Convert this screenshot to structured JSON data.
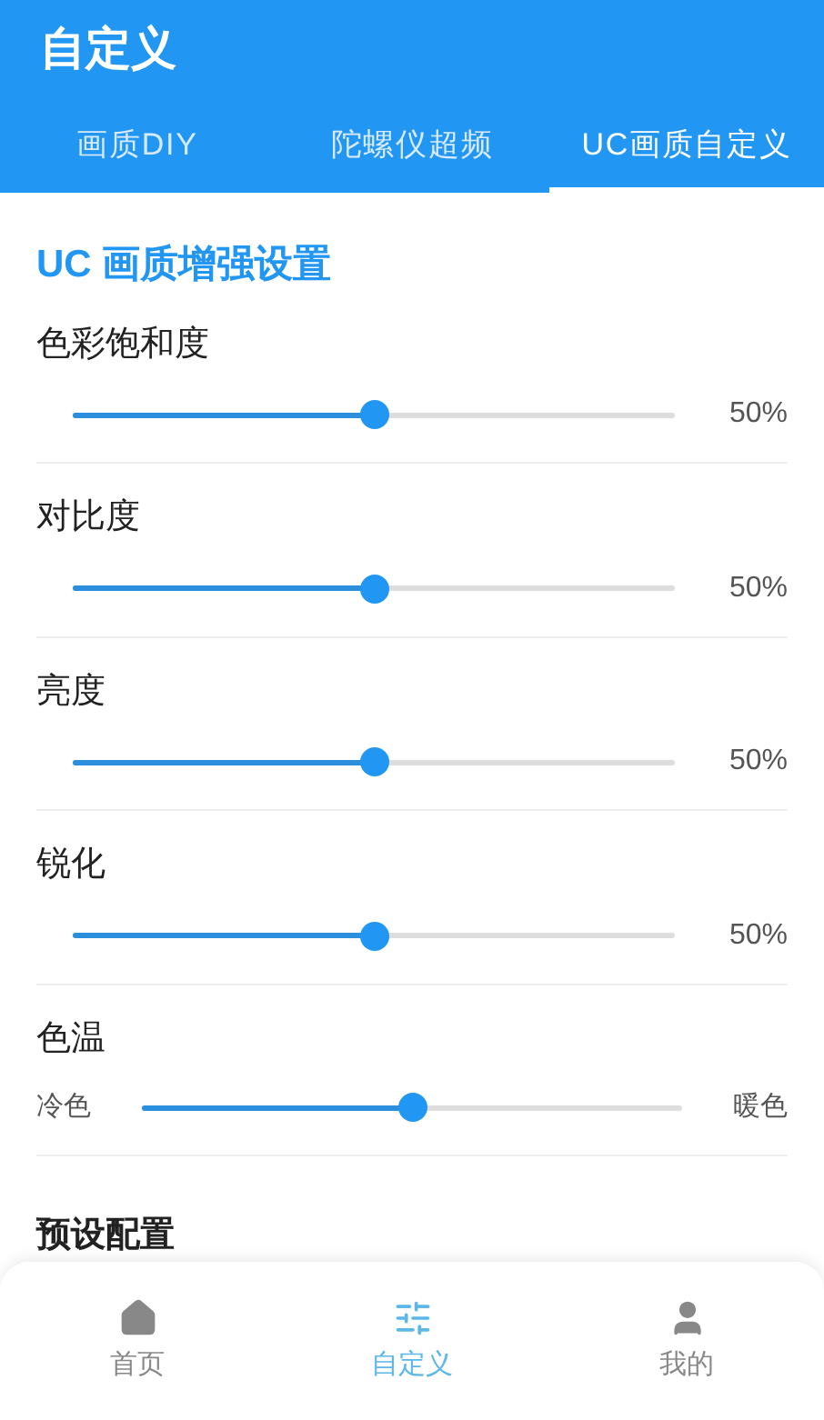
{
  "window": {
    "title": "自定义"
  },
  "tabs": [
    {
      "label": "画质DIY",
      "selected": false
    },
    {
      "label": "陀螺仪超频",
      "selected": false
    },
    {
      "label": "UC画质自定义",
      "selected": true
    }
  ],
  "section_title": "UC 画质增强设置",
  "settings": [
    {
      "kind": "percent",
      "name": "色彩饱和度",
      "level": 0.5,
      "reading": "50%"
    },
    {
      "kind": "percent",
      "name": "对比度",
      "level": 0.5,
      "reading": "50%"
    },
    {
      "kind": "percent",
      "name": "亮度",
      "level": 0.5,
      "reading": "50%"
    },
    {
      "kind": "percent",
      "name": "锐化",
      "level": 0.5,
      "reading": "50%"
    },
    {
      "kind": "range",
      "name": "色温",
      "level": 0.5,
      "min_label": "冷色",
      "max_label": "暖色"
    }
  ],
  "presets_title": "预设配置",
  "bottom_nav": [
    {
      "kind": "home",
      "label": "首页",
      "selected": false
    },
    {
      "kind": "sliders",
      "label": "自定义",
      "selected": true
    },
    {
      "kind": "user",
      "label": "我的",
      "selected": false
    }
  ]
}
